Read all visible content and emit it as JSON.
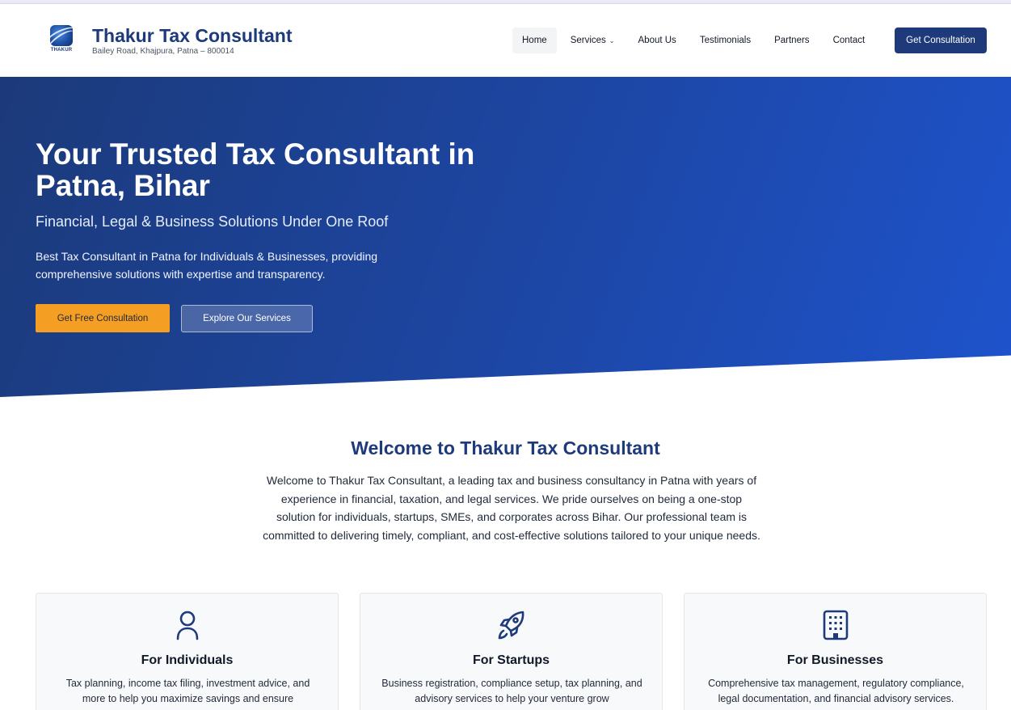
{
  "brand": {
    "logo_text": "THAKUR",
    "title": "Thakur Tax Consultant",
    "address": "Bailey Road, Khajpura, Patna – 800014"
  },
  "nav": {
    "items": [
      {
        "label": "Home",
        "active": true
      },
      {
        "label": "Services",
        "has_dropdown": true
      },
      {
        "label": "About Us"
      },
      {
        "label": "Testimonials"
      },
      {
        "label": "Partners"
      },
      {
        "label": "Contact"
      }
    ],
    "cta": "Get Consultation",
    "dropdown_icon": "chevron-down-icon"
  },
  "hero": {
    "title": "Your Trusted Tax Consultant in Patna, Bihar",
    "subtitle": "Financial, Legal & Business Solutions Under One Roof",
    "description": "Best Tax Consultant in Patna for Individuals & Businesses, providing comprehensive solutions with expertise and transparency.",
    "primary_button": "Get Free Consultation",
    "secondary_button": "Explore Our Services"
  },
  "welcome": {
    "title": "Welcome to Thakur Tax Consultant",
    "text": "Welcome to Thakur Tax Consultant, a leading tax and business consultancy in Patna with years of experience in financial, taxation, and legal services. We pride ourselves on being a one-stop solution for individuals, startups, SMEs, and corporates across Bihar. Our professional team is committed to delivering timely, compliant, and cost-effective solutions tailored to your unique needs."
  },
  "cards": [
    {
      "icon": "user-icon",
      "title": "For Individuals",
      "text": "Tax planning, income tax filing, investment advice, and more to help you maximize savings and ensure"
    },
    {
      "icon": "rocket-icon",
      "title": "For Startups",
      "text": "Business registration, compliance setup, tax planning, and advisory services to help your venture grow"
    },
    {
      "icon": "building-icon",
      "title": "For Businesses",
      "text": "Comprehensive tax management, regulatory compliance, legal documentation, and financial advisory services."
    }
  ],
  "colors": {
    "brand_navy": "#1e3a7a",
    "hero_gradient_start": "#1c3a7a",
    "hero_gradient_end": "#1e53cc",
    "accent_orange": "#f59e24"
  }
}
